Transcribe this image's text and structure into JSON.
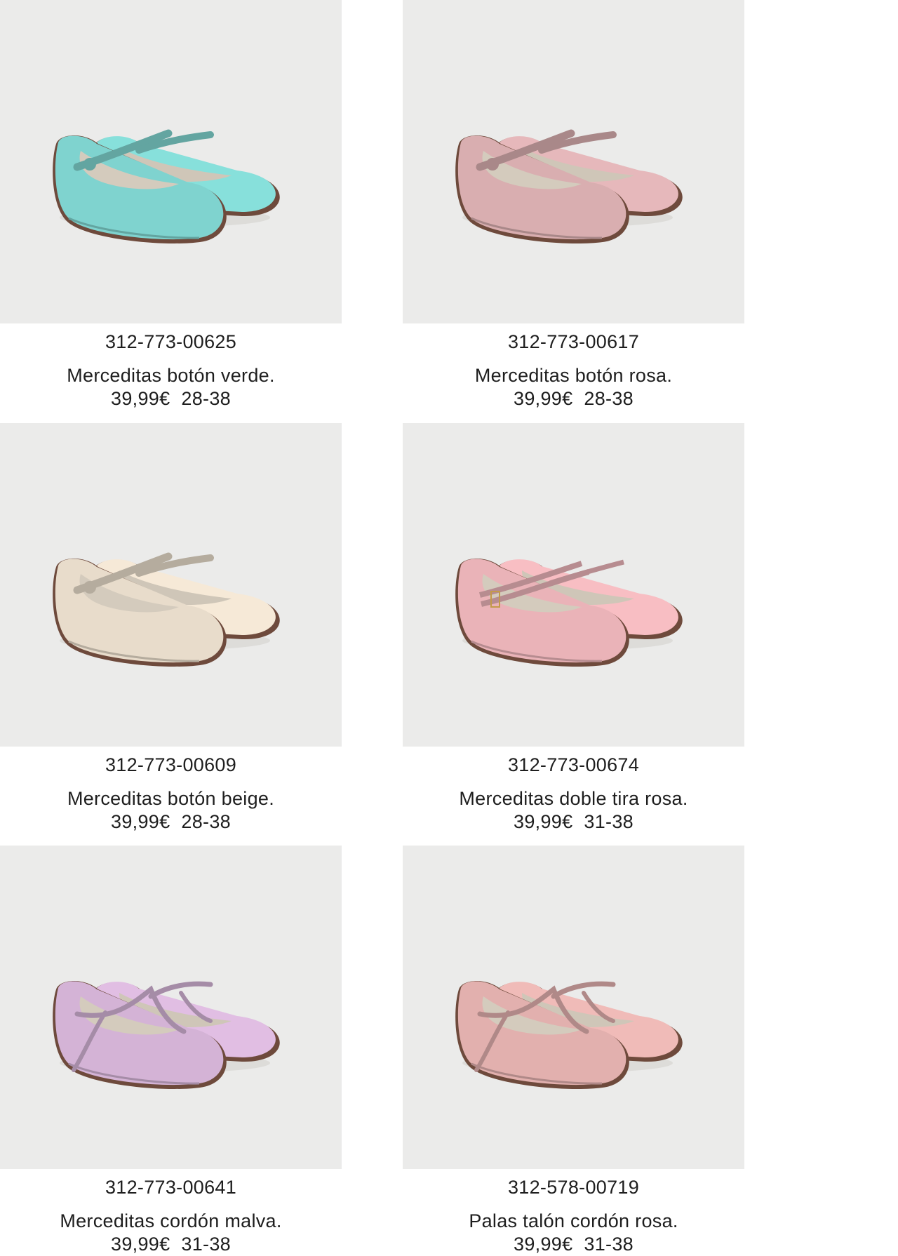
{
  "flag_colors": [
    "#2b3f8f",
    "#ffffff",
    "#d42b2b"
  ],
  "products": [
    {
      "code": "312-773-00625",
      "name": "Merceditas botón verde.",
      "price": "39,99€",
      "sizes": "28-38",
      "color": "#7fd3cf",
      "style": "button-strap",
      "icon": "shoe-image"
    },
    {
      "code": "312-773-00617",
      "name": "Merceditas botón rosa.",
      "price": "39,99€",
      "sizes": "28-38",
      "color": "#d9aeb0",
      "style": "button-strap",
      "icon": "shoe-image"
    },
    {
      "code": "312-773-00609",
      "name": "Merceditas botón beige.",
      "price": "39,99€",
      "sizes": "28-38",
      "color": "#e8dccb",
      "style": "button-strap",
      "icon": "shoe-image"
    },
    {
      "code": "312-773-00674",
      "name": "Merceditas doble tira rosa.",
      "price": "39,99€",
      "sizes": "31-38",
      "color": "#eab3b8",
      "style": "double-strap",
      "icon": "shoe-image"
    },
    {
      "code": "312-773-00641",
      "name": "Merceditas cordón malva.",
      "price": "39,99€",
      "sizes": "31-38",
      "color": "#d4b3d6",
      "style": "ribbon",
      "icon": "shoe-image"
    },
    {
      "code": "312-578-00719",
      "name": "Palas talón cordón rosa.",
      "price": "39,99€",
      "sizes": "31-38",
      "color": "#e2b0ae",
      "style": "ribbon",
      "icon": "shoe-image"
    }
  ]
}
